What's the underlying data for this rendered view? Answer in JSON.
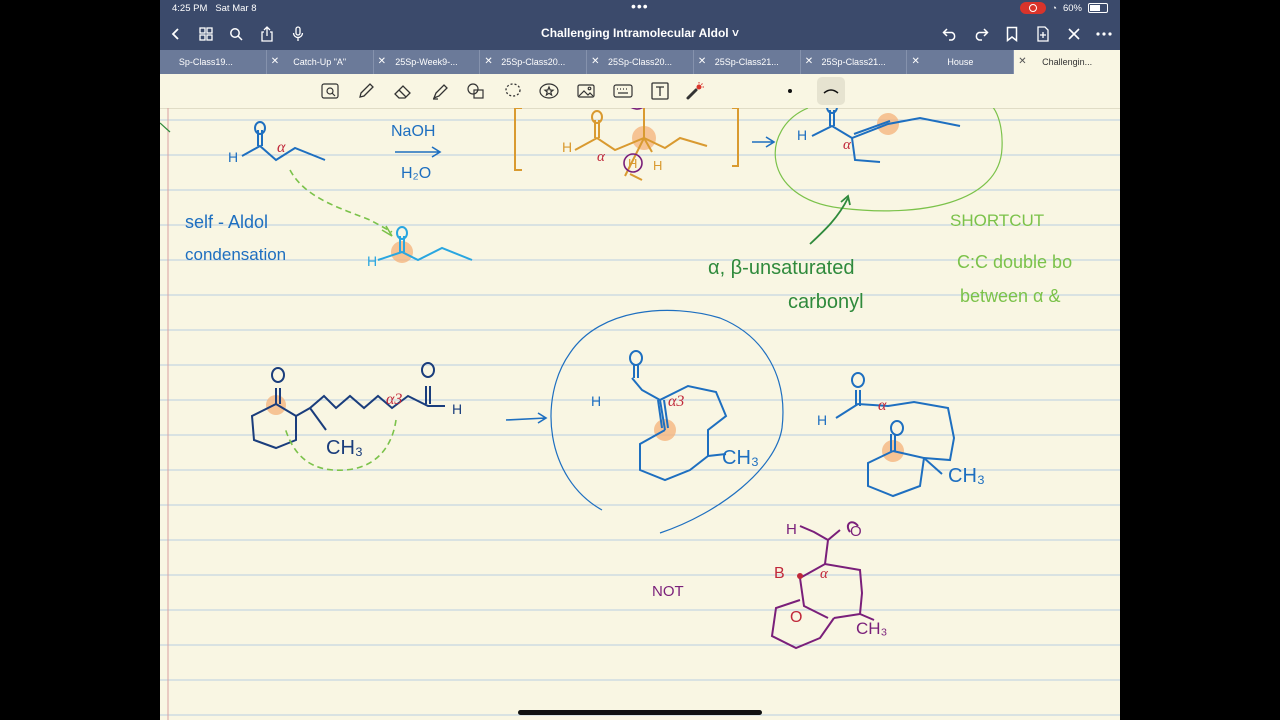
{
  "status": {
    "time": "4:25 PM",
    "date": "Sat Mar 8",
    "battery": "60%",
    "battery_level": 0.6
  },
  "nav": {
    "title": "Challenging Intramolecular Aldol ˅"
  },
  "tabs": [
    {
      "label": "Sp-Class19..."
    },
    {
      "label": "Catch-Up \"A\""
    },
    {
      "label": "25Sp-Week9-..."
    },
    {
      "label": "25Sp-Class20..."
    },
    {
      "label": "25Sp-Class20..."
    },
    {
      "label": "25Sp-Class21..."
    },
    {
      "label": "25Sp-Class21..."
    },
    {
      "label": "House"
    },
    {
      "label": "Challengin..."
    }
  ],
  "icons": {
    "back": "chevron-left-icon",
    "grid": "grid-icon",
    "search": "search-icon",
    "share": "share-icon",
    "mic": "microphone-icon",
    "undo": "undo-icon",
    "redo": "redo-icon",
    "bookmark": "bookmark-icon",
    "add_page": "add-page-icon",
    "close": "close-icon",
    "more": "more-icon"
  },
  "colors": {
    "header": "#3b4a6b",
    "tabbar": "#6b7a99",
    "paper": "#f9f6e3",
    "rule": "#b9cde0",
    "margin": "#d9a0a0",
    "blue": "#1e6fc0",
    "navy": "#1a3d7c",
    "orange": "#d99a30",
    "red": "#c0283a",
    "green": "#2f8a3c",
    "lightgreen": "#7bc24a",
    "cyan": "#29a6e0",
    "purple": "#7a1f7a",
    "highlight": "#f4b27a"
  },
  "notes": {
    "naoh": "NaOH",
    "h2o": "H₂O",
    "self_aldol_1": "self - Aldol",
    "self_aldol_2": "condensation",
    "alpha_beta_1": "α, β-unsaturated",
    "alpha_beta_2": "carbonyl",
    "shortcut": "SHORTCUT",
    "cc_1": "C:C double bo",
    "cc_2": "between α &",
    "not": "NOT",
    "ch3": "CH₃",
    "h": "H",
    "o": "O",
    "alpha": "α",
    "alpha3": "α3",
    "beta": "B"
  }
}
